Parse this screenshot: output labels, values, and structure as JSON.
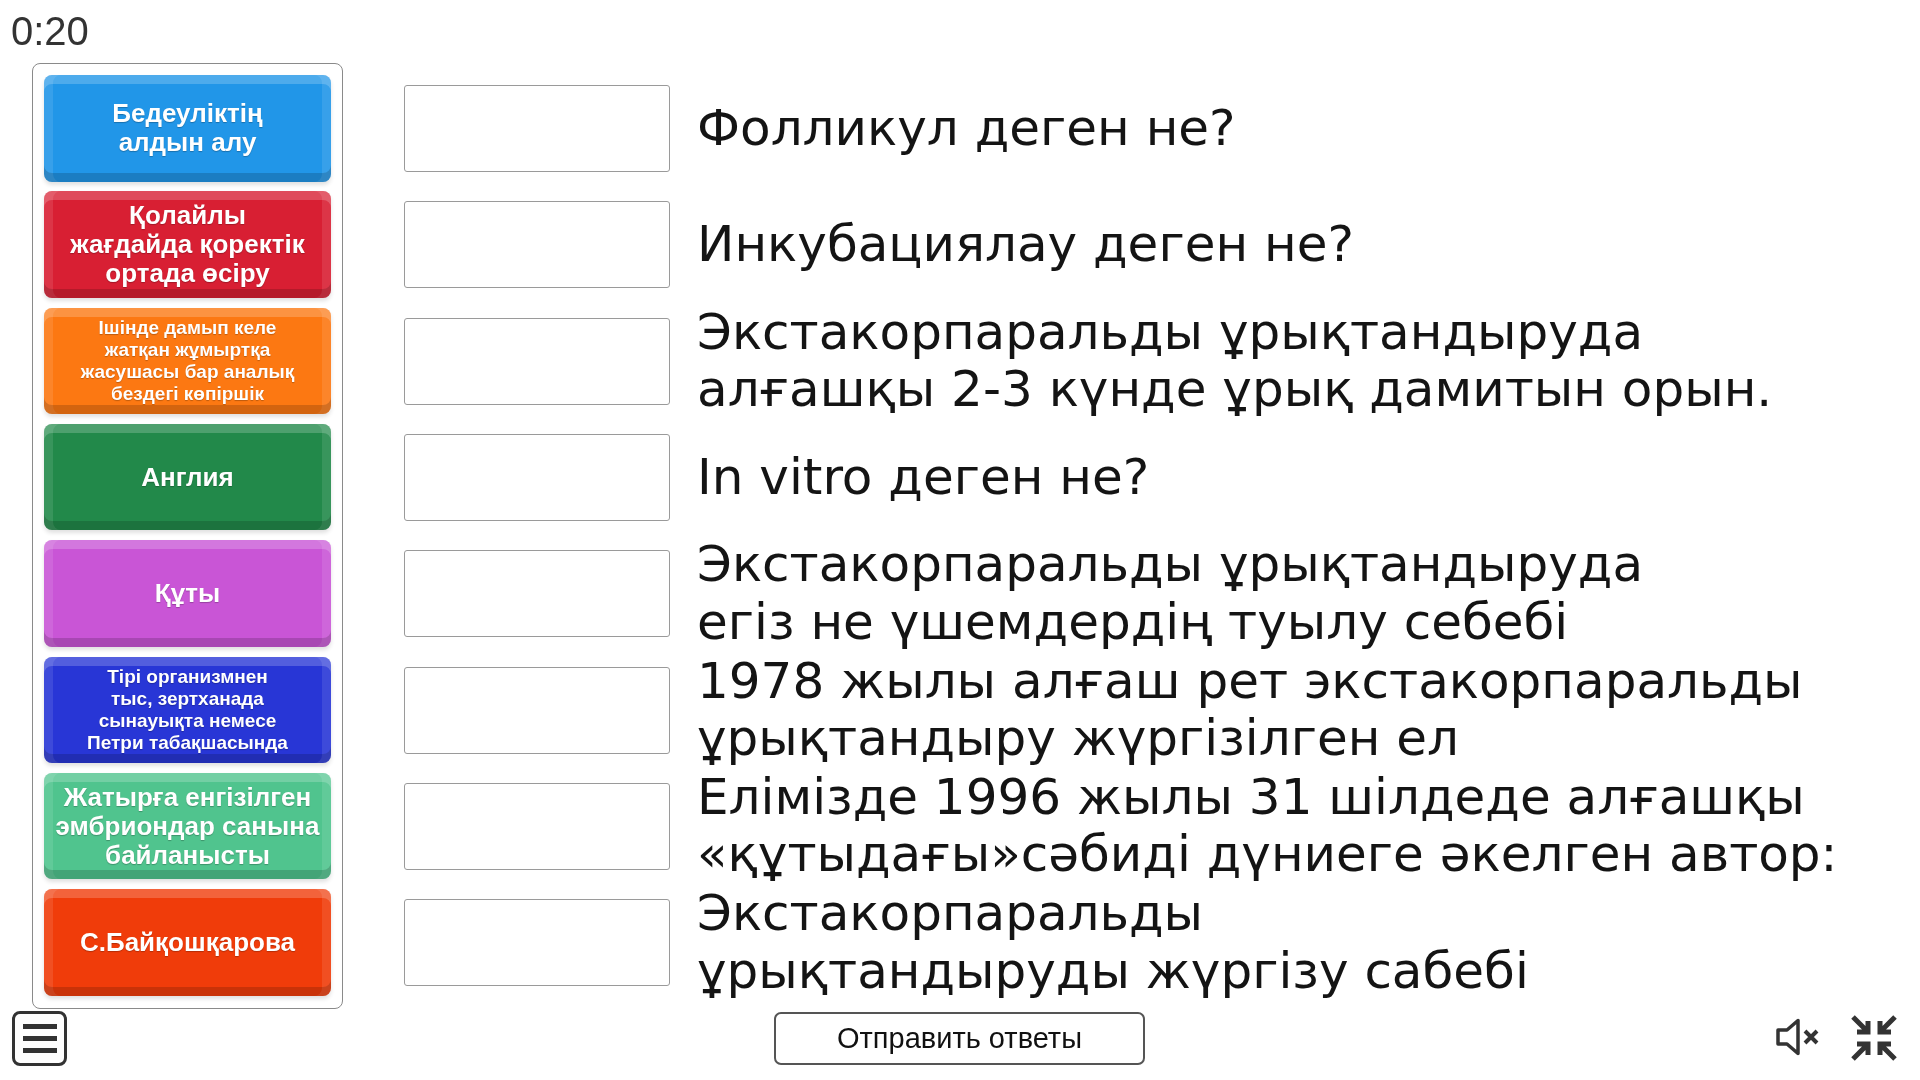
{
  "timer": "0:20",
  "answer_tiles": [
    {
      "text": "Бедеуліктің\nалдын алу",
      "color": "#2196e8"
    },
    {
      "text": "Қолайлы\nжағдайда қоректік\nортада өсіру",
      "color": "#d81f33"
    },
    {
      "text": "Ішінде дамып келе\nжатқан жұмыртқа\nжасушасы бар аналық\nбездегі көпіршік",
      "color": "#fc7812"
    },
    {
      "text": "Англия",
      "color": "#22894a"
    },
    {
      "text": "Құты",
      "color": "#c955d6"
    },
    {
      "text": "Тірі организмнен\nтыс, зертханада\nсынауықта немесе\nПетри табақшасында",
      "color": "#2836d6"
    },
    {
      "text": "Жатырға енгізілген\nэмбриондар санына\nбайланысты",
      "color": "#50c48e"
    },
    {
      "text": "С.Байқошқарова",
      "color": "#f03c0a"
    }
  ],
  "questions": [
    "Фолликул деген не?",
    "Инкубациялау деген не?",
    "Экстакорпаральды ұрықтандыруда\nалғашқы 2-3 күнде ұрық дамитын орын.",
    "In vitro деген не?",
    "Экстакорпаральды ұрықтандыруда\nегіз не үшемдердің туылу себебі",
    "1978 жылы алғаш рет экстакорпаральды\nұрықтандыру жүргізілген ел",
    "Елімізде 1996 жылы 31 шілдеде алғашқы\n«құтыдағы»сәбиді дүниеге әкелген автор:",
    "Экстакорпаральды\nұрықтандыруды жүргізу сабебі"
  ],
  "submit_button": "Отправить ответы"
}
